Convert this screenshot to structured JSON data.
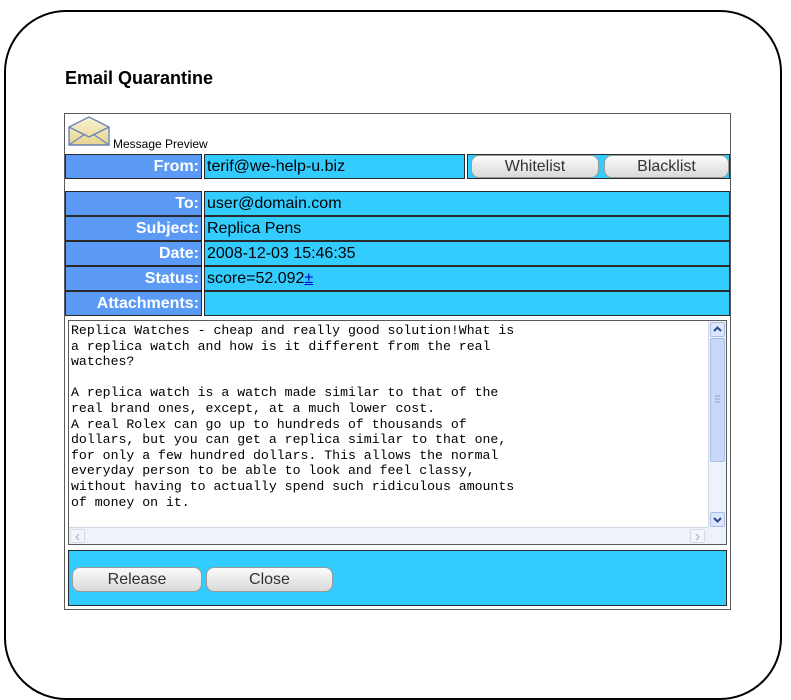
{
  "title": "Email Quarantine",
  "preview_label": "Message Preview",
  "fields": {
    "from_label": "From:",
    "from_value": "terif@we-help-u.biz",
    "to_label": "To:",
    "to_value": "user@domain.com",
    "subject_label": "Subject:",
    "subject_value": "Replica Pens",
    "date_label": "Date:",
    "date_value": "2008-12-03 15:46:35",
    "status_label": "Status:",
    "status_value": "score=52.092",
    "status_link": "±",
    "attachments_label": "Attachments:",
    "attachments_value": ""
  },
  "buttons": {
    "whitelist": "Whitelist",
    "blacklist": "Blacklist",
    "release": "Release",
    "close": "Close"
  },
  "message_body": "Replica Watches - cheap and really good solution!What is\na replica watch and how is it different from the real\nwatches?\n\nA replica watch is a watch made similar to that of the\nreal brand ones, except, at a much lower cost.\nA real Rolex can go up to hundreds of thousands of\ndollars, but you can get a replica similar to that one,\nfor only a few hundred dollars. This allows the normal\neveryday person to be able to look and feel classy,\nwithout having to actually spend such ridiculous amounts\nof money on it.",
  "colors": {
    "label_bg": "#5b9bf5",
    "value_bg": "#33ccff"
  },
  "icons": {
    "envelope": "envelope-icon",
    "scroll_up": "chevron-up-icon",
    "scroll_down": "chevron-down-icon",
    "scroll_left": "chevron-left-icon",
    "scroll_right": "chevron-right-icon"
  }
}
